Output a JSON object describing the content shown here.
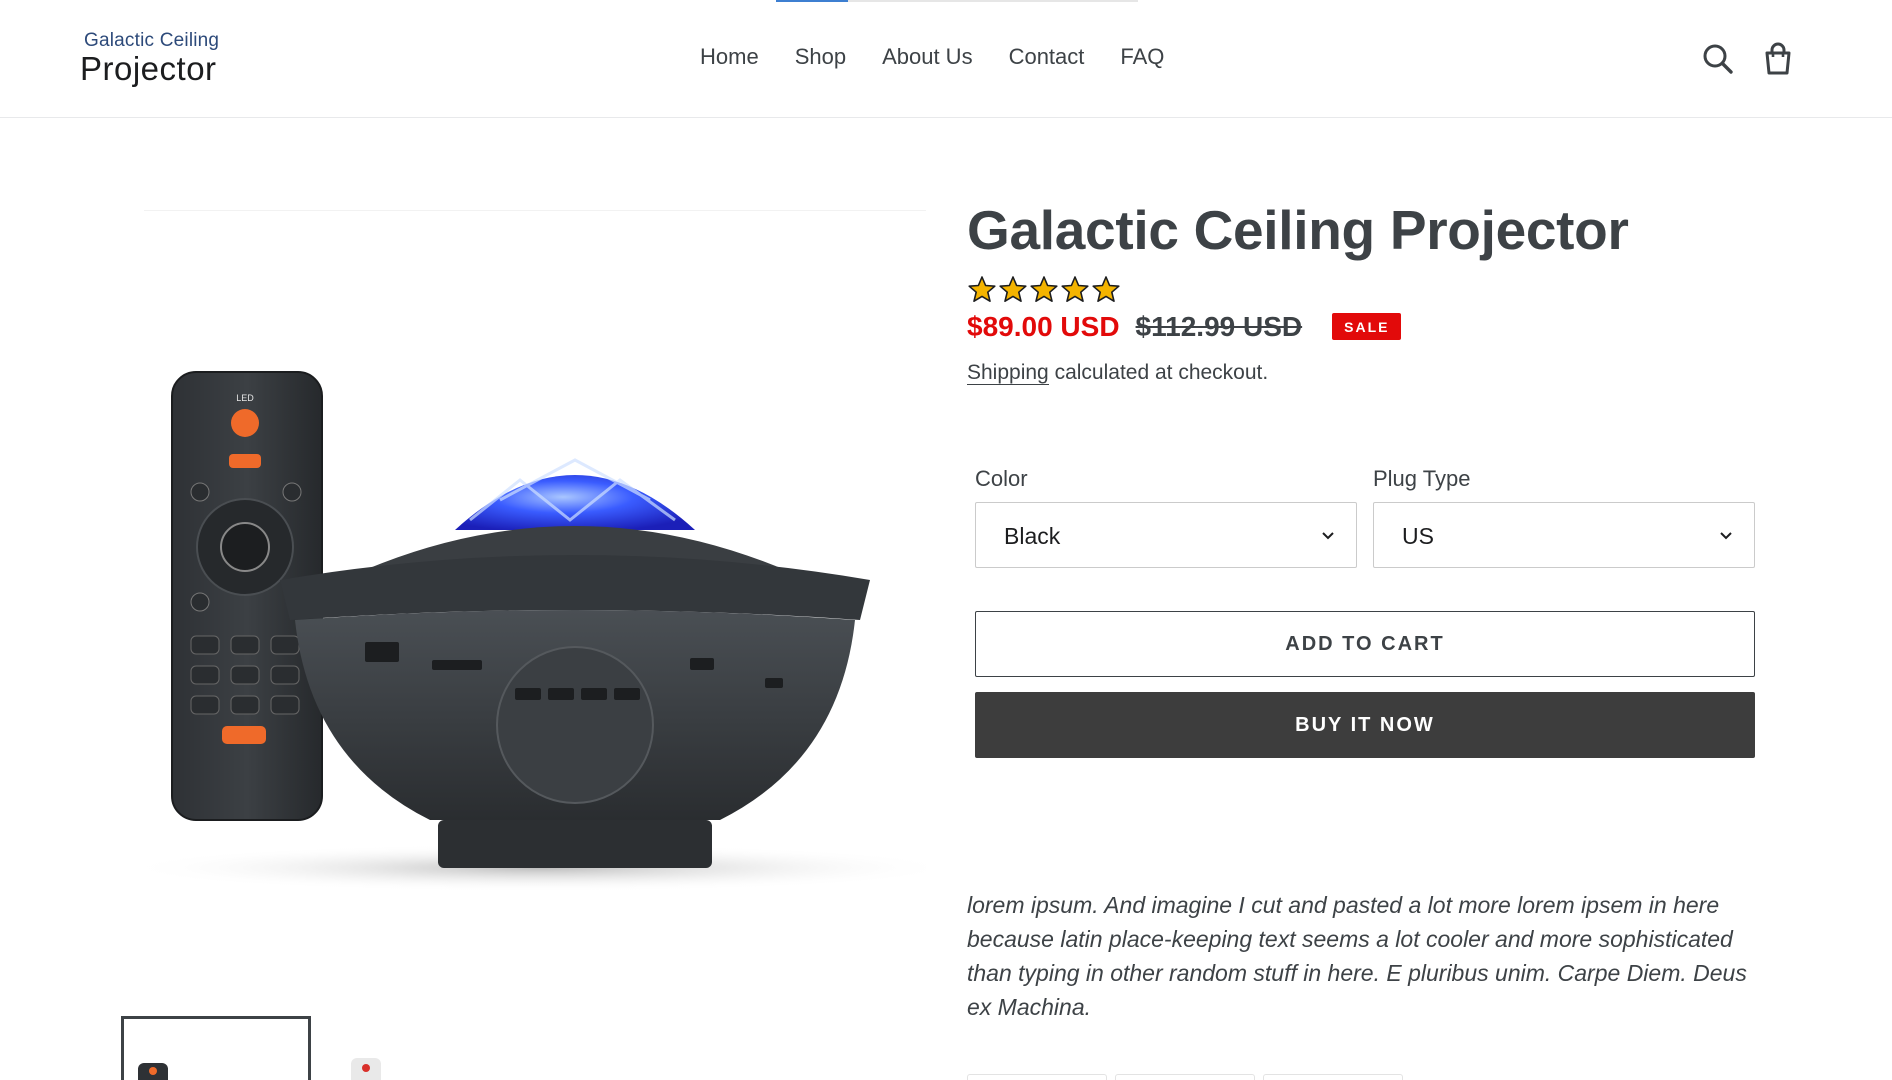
{
  "loading": {
    "progress": 0.2
  },
  "brand": {
    "line1": "Galactic Ceiling",
    "line2": "Projector"
  },
  "nav": {
    "items": [
      {
        "label": "Home"
      },
      {
        "label": "Shop"
      },
      {
        "label": "About Us"
      },
      {
        "label": "Contact"
      },
      {
        "label": "FAQ"
      }
    ]
  },
  "header_icons": [
    "search-icon",
    "cart-icon"
  ],
  "product": {
    "title": "Galactic Ceiling Projector",
    "rating": 5,
    "rating_max": 5,
    "sale_price": "$89.00 USD",
    "compare_price": "$112.99 USD",
    "sale_badge": "SALE",
    "shipping_link": "Shipping",
    "shipping_text": " calculated at checkout.",
    "options": {
      "color": {
        "label": "Color",
        "value": "Black"
      },
      "plug": {
        "label": "Plug Type",
        "value": "US"
      }
    },
    "add_to_cart": "ADD TO CART",
    "buy_now": "BUY IT NOW",
    "description": "lorem ipsum.  And imagine I cut and pasted a lot more lorem ipsem in here because latin place-keeping text seems a lot cooler and more sophisticated than typing in other random stuff in here.  E pluribus unim.  Carpe Diem.  Deus ex Machina."
  },
  "colors": {
    "sale": "#e20a0a",
    "text": "#3d4246",
    "button_dark": "#3d3d3d",
    "star": "#f4b400"
  }
}
